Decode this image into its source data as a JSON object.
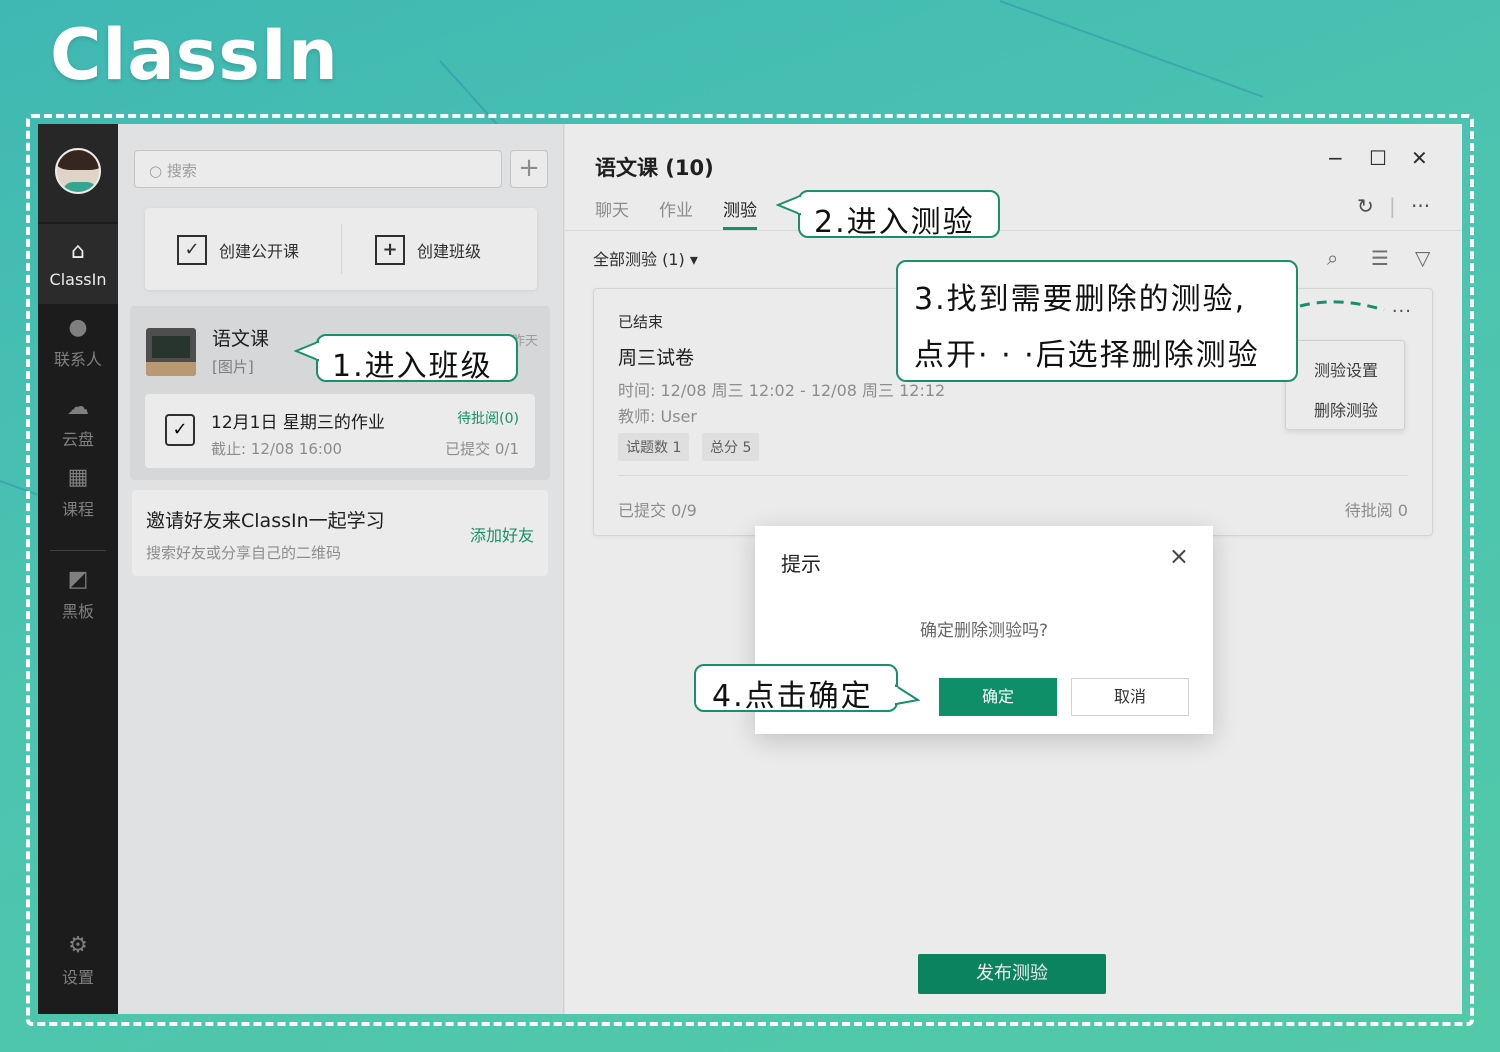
{
  "brand": "ClassIn",
  "sidebar": {
    "items": [
      {
        "label": "ClassIn",
        "icon": "home-icon"
      },
      {
        "label": "联系人",
        "icon": "contact-icon"
      },
      {
        "label": "云盘",
        "icon": "cloud-icon"
      },
      {
        "label": "课程",
        "icon": "calendar-icon"
      },
      {
        "label": "黑板",
        "icon": "blackboard-icon"
      },
      {
        "label": "设置",
        "icon": "settings-icon"
      }
    ]
  },
  "middle": {
    "search_placeholder": "搜索",
    "create_public": "创建公开课",
    "create_class": "创建班级",
    "class_name": "语文课",
    "class_sub": "[图片]",
    "class_time": "昨天",
    "homework": {
      "title": "12月1日 星期三的作业",
      "due": "截止: 12/08 16:00",
      "status": "待批阅(0)",
      "submitted": "已提交 0/1"
    },
    "invite": {
      "title": "邀请好友来ClassIn一起学习",
      "sub": "搜索好友或分享自己的二维码",
      "action": "添加好友"
    }
  },
  "right": {
    "title": "语文课 (10)",
    "tabs": [
      "聊天",
      "作业",
      "测验"
    ],
    "filter": "全部测验 (1) ▾",
    "quiz": {
      "status": "已结束",
      "name": "周三试卷",
      "time": "时间: 12/08 周三 12:02 - 12/08 周三 12:12",
      "teacher": "教师: User",
      "tags": [
        "试题数 1",
        "总分 5"
      ],
      "submitted": "已提交 0/9",
      "pending": "待批阅 0",
      "more": "···"
    },
    "menu": [
      "测验设置",
      "删除测验"
    ],
    "publish": "发布测验"
  },
  "dialog": {
    "title": "提示",
    "message": "确定删除测验吗?",
    "ok": "确定",
    "cancel": "取消"
  },
  "callouts": {
    "step1": "1.进入班级",
    "step2": "2.进入测验",
    "step3_line1": "3.找到需要删除的测验,",
    "step3_line2": "点开· · ·后选择删除测验",
    "step4": "4.点击确定"
  },
  "colors": {
    "accent": "#0e8f68",
    "callout_border": "#1a8f6b",
    "background": "#45bfb0"
  }
}
